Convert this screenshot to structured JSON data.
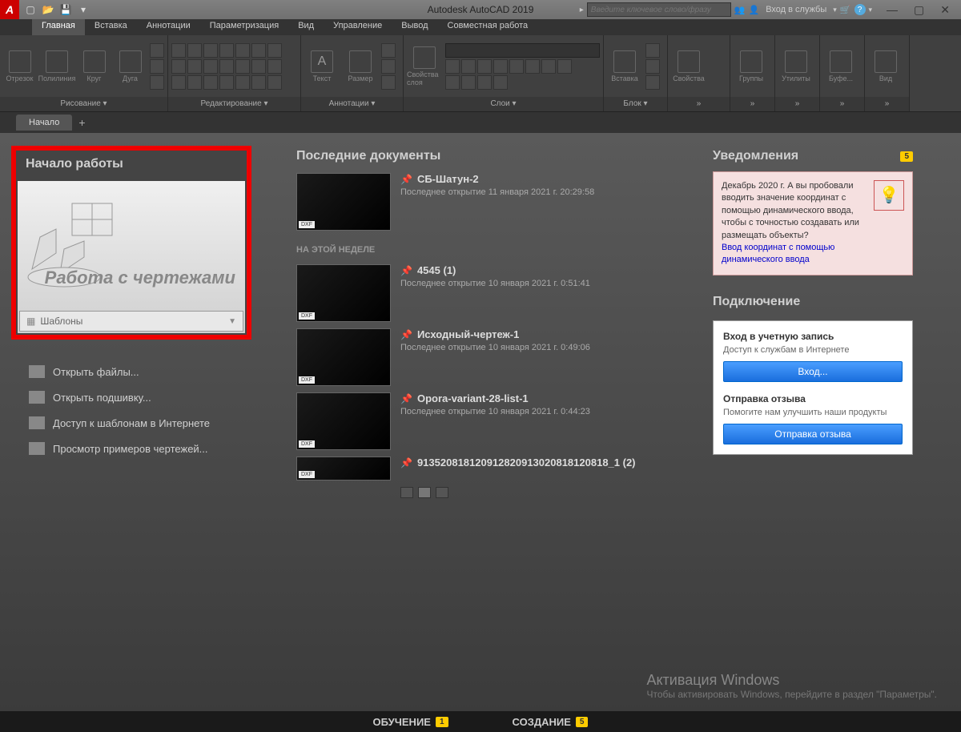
{
  "titlebar": {
    "app_title": "Autodesk AutoCAD 2019",
    "search_placeholder": "Введите ключевое слово/фразу",
    "login": "Вход в службы"
  },
  "menu": {
    "items": [
      "Главная",
      "Вставка",
      "Аннотации",
      "Параметризация",
      "Вид",
      "Управление",
      "Вывод",
      "Совместная работа"
    ],
    "active_index": 0
  },
  "ribbon": {
    "panels": [
      {
        "title": "Рисование ▾",
        "big": [
          "Отрезок",
          "Полилиния",
          "Круг",
          "Дуга"
        ]
      },
      {
        "title": "Редактирование ▾",
        "big": []
      },
      {
        "title": "Аннотации ▾",
        "big": [
          "Текст",
          "Размер"
        ]
      },
      {
        "title": "Слои ▾",
        "big": [
          "Свойства слоя"
        ]
      },
      {
        "title": "Блок ▾",
        "big": [
          "Вставка"
        ]
      },
      {
        "title": "",
        "big": [
          "Свойства"
        ]
      },
      {
        "title": "",
        "big": [
          "Группы"
        ]
      },
      {
        "title": "",
        "big": [
          "Утилиты"
        ]
      },
      {
        "title": "",
        "big": [
          "Буфе..."
        ]
      },
      {
        "title": "",
        "big": [
          "Вид"
        ]
      }
    ]
  },
  "doc_tab": "Начало",
  "start": {
    "getting_started": "Начало работы",
    "card_title": "Работа с чертежами",
    "templates": "Шаблоны",
    "links": [
      "Открыть файлы...",
      "Открыть подшивку...",
      "Доступ к шаблонам в Интернете",
      "Просмотр примеров чертежей..."
    ]
  },
  "recent": {
    "heading": "Последние документы",
    "week": "НА ЭТОЙ НЕДЕЛЕ",
    "items": [
      {
        "name": "СБ-Шатун-2",
        "meta": "Последнее открытие 11 января 2021 г. 20:29:58"
      },
      {
        "name": "4545 (1)",
        "meta": "Последнее открытие 10 января 2021 г. 0:51:41"
      },
      {
        "name": "Исходный-чертеж-1",
        "meta": "Последнее открытие 10 января 2021 г. 0:49:06"
      },
      {
        "name": "Opora-variant-28-list-1",
        "meta": "Последнее открытие 10 января 2021 г. 0:44:23"
      },
      {
        "name": "913520818120912820913020818120818_1 (2)",
        "meta": ""
      }
    ]
  },
  "notif": {
    "heading": "Уведомления",
    "count": "5",
    "body": "Декабрь 2020 г. А вы пробовали вводить значение координат с помощью динамического ввода, чтобы с точностью создавать или размещать объекты?",
    "link": "Ввод координат с помощью динамического ввода"
  },
  "connect": {
    "heading": "Подключение",
    "signin_h": "Вход в учетную запись",
    "signin_sub": "Доступ к службам в Интернете",
    "signin_btn": "Вход...",
    "feedback_h": "Отправка отзыва",
    "feedback_sub": "Помогите нам улучшить наши продукты",
    "feedback_btn": "Отправка отзыва"
  },
  "watermark": {
    "title": "Активация Windows",
    "sub": "Чтобы активировать Windows, перейдите в раздел \"Параметры\"."
  },
  "bottom": {
    "learn": "ОБУЧЕНИЕ",
    "learn_n": "1",
    "create": "СОЗДАНИЕ",
    "create_n": "5"
  }
}
